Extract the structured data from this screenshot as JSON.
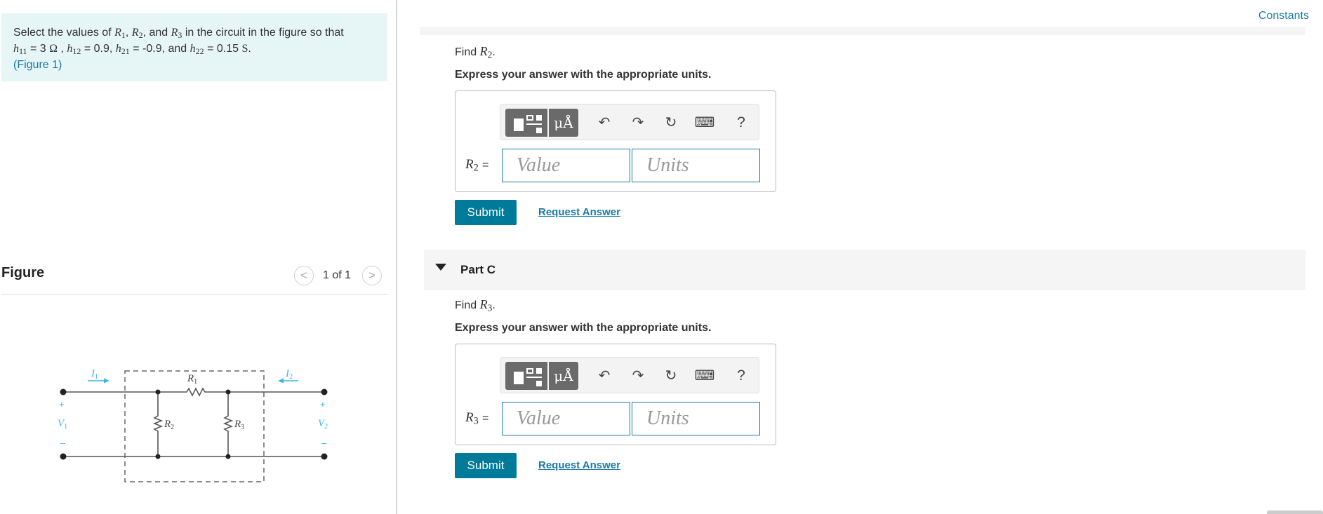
{
  "problem": {
    "intro": "Select the values of",
    "r1": "R",
    "r1_sub": "1",
    "sep1": ",",
    "r2": "R",
    "r2_sub": "2",
    "sep2": ", and",
    "r3": "R",
    "r3_sub": "3",
    "tail": "in the circuit in the figure so that",
    "h11": "h",
    "h11_sub": "11",
    "h11_val": "= 3",
    "ohm": "Ω",
    "sep3": ",",
    "h12": "h",
    "h12_sub": "12",
    "h12_val": "= 0.9,",
    "h21": "h",
    "h21_sub": "21",
    "h21_val": "= -0.9, and",
    "h22": "h",
    "h22_sub": "22",
    "h22_val": "= 0.15",
    "siemens": "S",
    "end": ".",
    "figure_link": "(Figure 1)"
  },
  "figure": {
    "title": "Figure",
    "prev_label": "<",
    "next_label": ">",
    "count": "1 of 1",
    "labels": {
      "i1": "I",
      "i1_sub": "1",
      "i2": "I",
      "i2_sub": "2",
      "r1": "R",
      "r1_sub": "1",
      "r2": "R",
      "r2_sub": "2",
      "r3": "R",
      "r3_sub": "3",
      "v1": "V",
      "v1_sub": "1",
      "v2": "V",
      "v2_sub": "2",
      "plus": "+",
      "minus": "–"
    },
    "colors": {
      "wire": "#555555",
      "accent": "#3bb4e5",
      "dash": "#666666"
    }
  },
  "header": {
    "constants_link": "Constants"
  },
  "part_b": {
    "find_prefix": "Find",
    "find_var": "R",
    "find_sub": "2",
    "find_end": ".",
    "express": "Express your answer with the appropriate units.",
    "var_label": "R",
    "var_sub": "2",
    "var_eq": "=",
    "value_placeholder": "Value",
    "units_placeholder": "Units",
    "submit": "Submit",
    "request": "Request Answer"
  },
  "part_c": {
    "title": "Part C",
    "find_prefix": "Find",
    "find_var": "R",
    "find_sub": "3",
    "find_end": ".",
    "express": "Express your answer with the appropriate units.",
    "var_label": "R",
    "var_sub": "3",
    "var_eq": "=",
    "value_placeholder": "Value",
    "units_placeholder": "Units",
    "submit": "Submit",
    "request": "Request Answer"
  },
  "toolbar": {
    "units_label": "μÅ",
    "undo": "↶",
    "redo": "↷",
    "reset": "↻",
    "keyboard": "⌨",
    "help": "?",
    "icons": [
      "templates-icon",
      "units-icon",
      "undo-icon",
      "redo-icon",
      "reset-icon",
      "keyboard-icon",
      "help-icon"
    ]
  },
  "colors": {
    "accent": "#007a99",
    "link": "#1a7aa6",
    "problem_bg": "#e6f5f6"
  }
}
